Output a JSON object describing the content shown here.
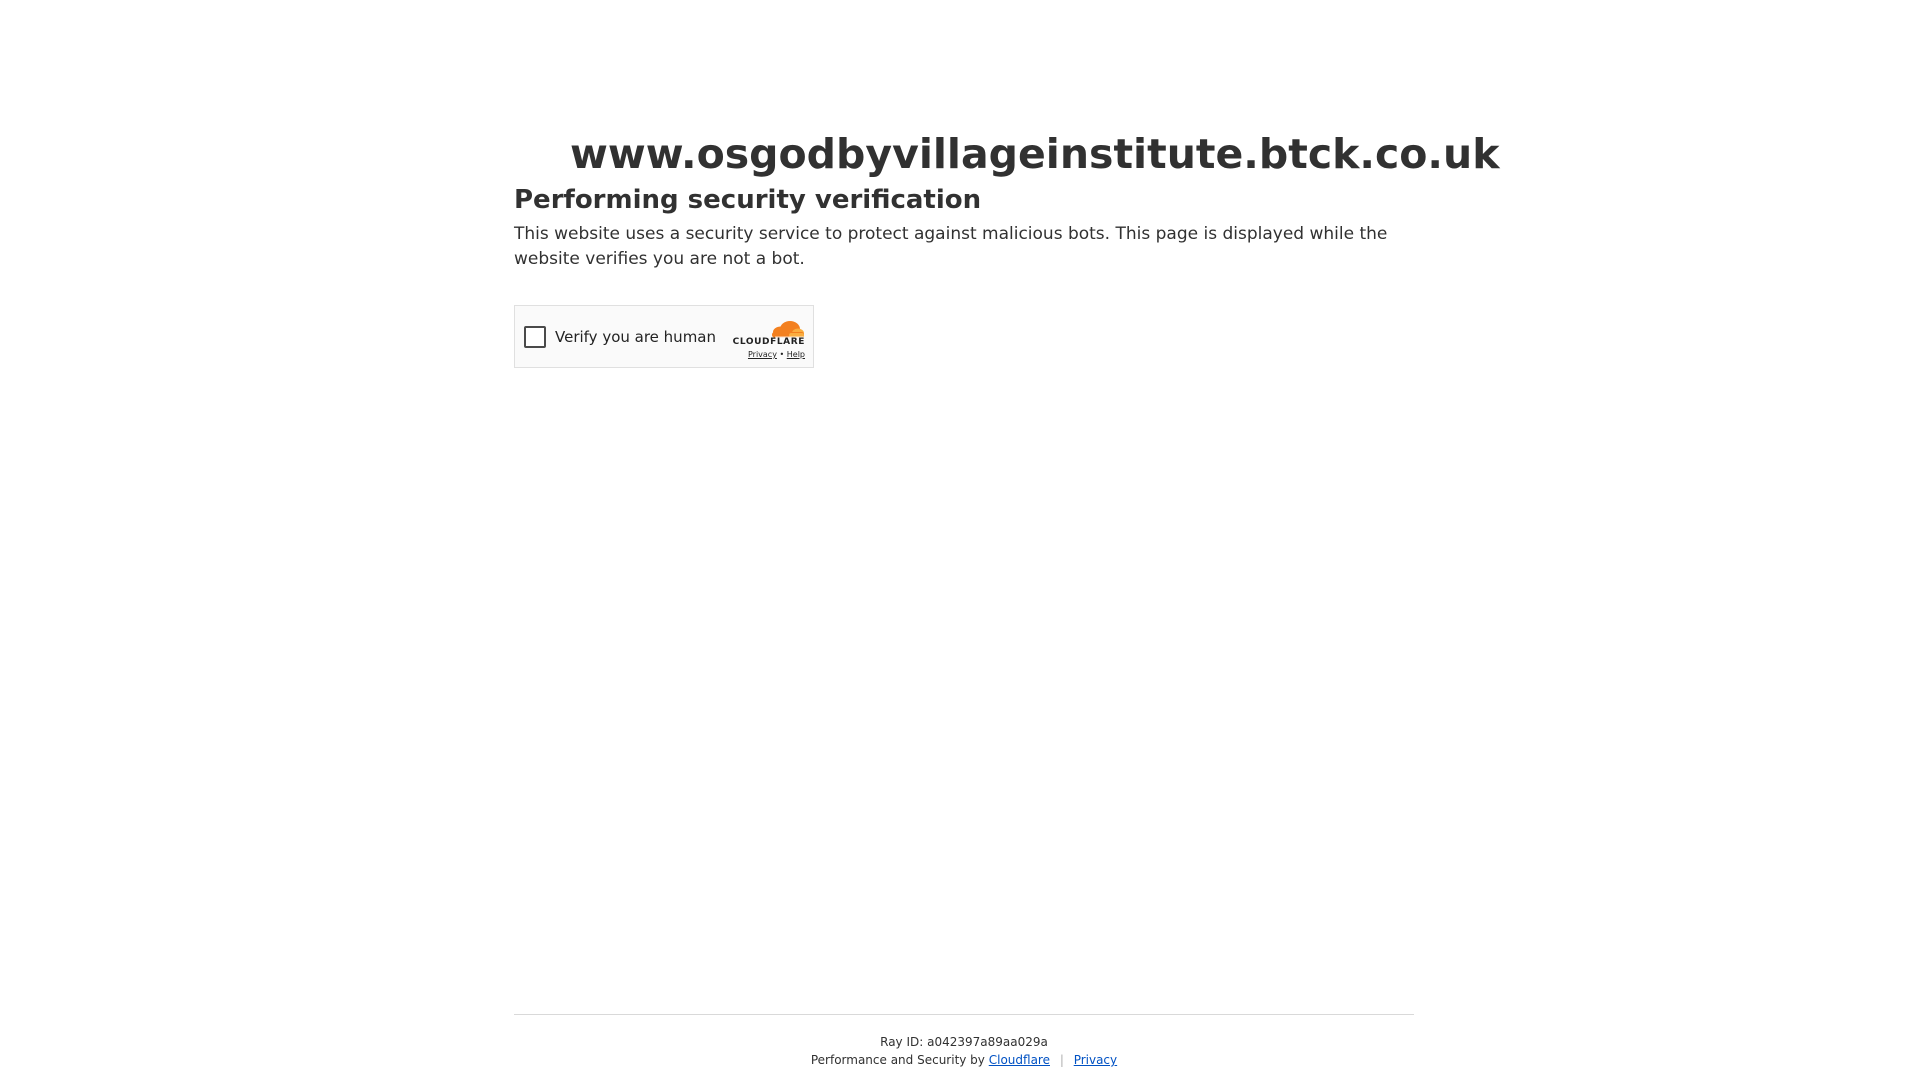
{
  "site": {
    "domain": "www.osgodbyvillageinstitute.btck.co.uk"
  },
  "main": {
    "heading": "Performing security verification",
    "description": "This website uses a security service to protect against malicious bots. This page is displayed while the website verifies you are not a bot."
  },
  "widget": {
    "checkbox_label": "Verify you are human",
    "brand": "CLOUDFLARE",
    "privacy_link": "Privacy",
    "link_separator": "•",
    "help_link": "Help",
    "brand_color": "#f38020"
  },
  "footer": {
    "ray_id": "Ray ID: a042397a89aa029a",
    "perf_text": "Performance and Security by",
    "cloudflare_link": "Cloudflare",
    "separator": "|",
    "privacy_link": "Privacy",
    "link_color": "#0051c3"
  }
}
